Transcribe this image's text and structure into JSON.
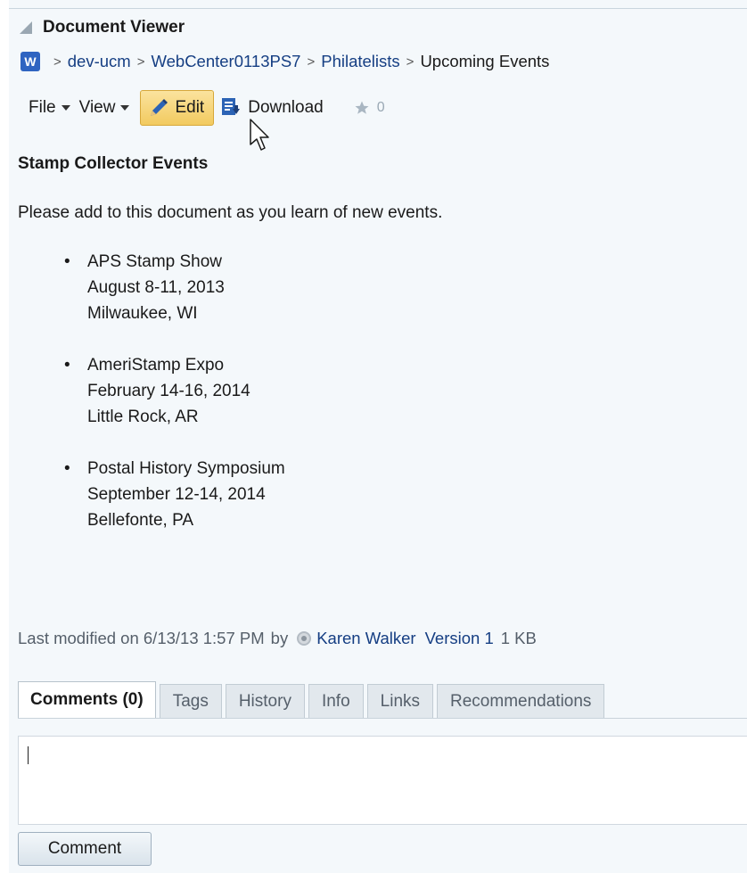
{
  "panel": {
    "title": "Document Viewer"
  },
  "breadcrumb": {
    "items": [
      "dev-ucm",
      "WebCenter0113PS7",
      "Philatelists",
      "Upcoming Events"
    ],
    "separator": ">",
    "icon_label": "W"
  },
  "toolbar": {
    "file_label": "File",
    "view_label": "View",
    "edit_label": "Edit",
    "download_label": "Download",
    "rating_count": "0"
  },
  "document": {
    "title": "Stamp Collector Events",
    "intro": "Please add to this document as you learn of new events.",
    "events": [
      {
        "name": "APS Stamp Show",
        "date": "August 8-11, 2013",
        "location": "Milwaukee, WI"
      },
      {
        "name": "AmeriStamp Expo",
        "date": "February 14-16, 2014",
        "location": "Little Rock, AR"
      },
      {
        "name": "Postal History Symposium",
        "date": "September 12-14, 2014",
        "location": "Bellefonte, PA"
      }
    ]
  },
  "meta": {
    "modified_prefix": "Last modified on 6/13/13 1:57 PM",
    "by_label": "by",
    "author": "Karen Walker",
    "version": "Version 1",
    "size": "1 KB"
  },
  "tabs": [
    {
      "label": "Comments (0)",
      "active": true
    },
    {
      "label": "Tags",
      "active": false
    },
    {
      "label": "History",
      "active": false
    },
    {
      "label": "Info",
      "active": false
    },
    {
      "label": "Links",
      "active": false
    },
    {
      "label": "Recommendations",
      "active": false
    }
  ],
  "comment": {
    "value": "",
    "button_label": "Comment"
  },
  "colors": {
    "link": "#153e83",
    "edit_highlight": "#f2ca5f",
    "panel_bg": "#f4f8fb"
  },
  "icons": [
    "collapse-triangle-icon",
    "word-document-icon",
    "pencil-icon",
    "download-icon",
    "star-icon",
    "mouse-pointer-icon",
    "presence-status-icon"
  ]
}
